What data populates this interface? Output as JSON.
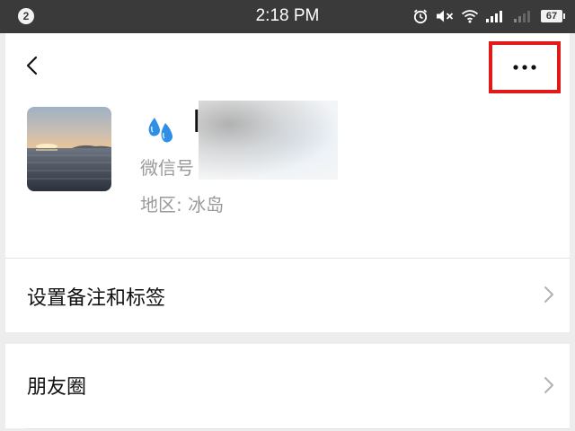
{
  "status_bar": {
    "notification_count": "2",
    "time": "2:18 PM",
    "battery_level": "67",
    "icons": [
      "alarm-icon",
      "mute-icon",
      "wifi-icon",
      "signal-icon",
      "signal-weak-icon",
      "battery-icon"
    ]
  },
  "header": {
    "back_icon": "chevron-left-icon",
    "more_icon": "ellipsis-icon",
    "highlight_color": "#e11919"
  },
  "profile": {
    "avatar_icon": "sunset-sea-photo",
    "nickname_emoji": "water-drops-emoji",
    "nickname_visible": "l",
    "wechat_id_label": "微信号",
    "region_label": "地区:",
    "region_value": "冰岛"
  },
  "list": {
    "items": [
      {
        "label": "设置备注和标签",
        "icon": "chevron-right-icon"
      },
      {
        "label": "朋友圈",
        "icon": "chevron-right-icon"
      }
    ]
  }
}
